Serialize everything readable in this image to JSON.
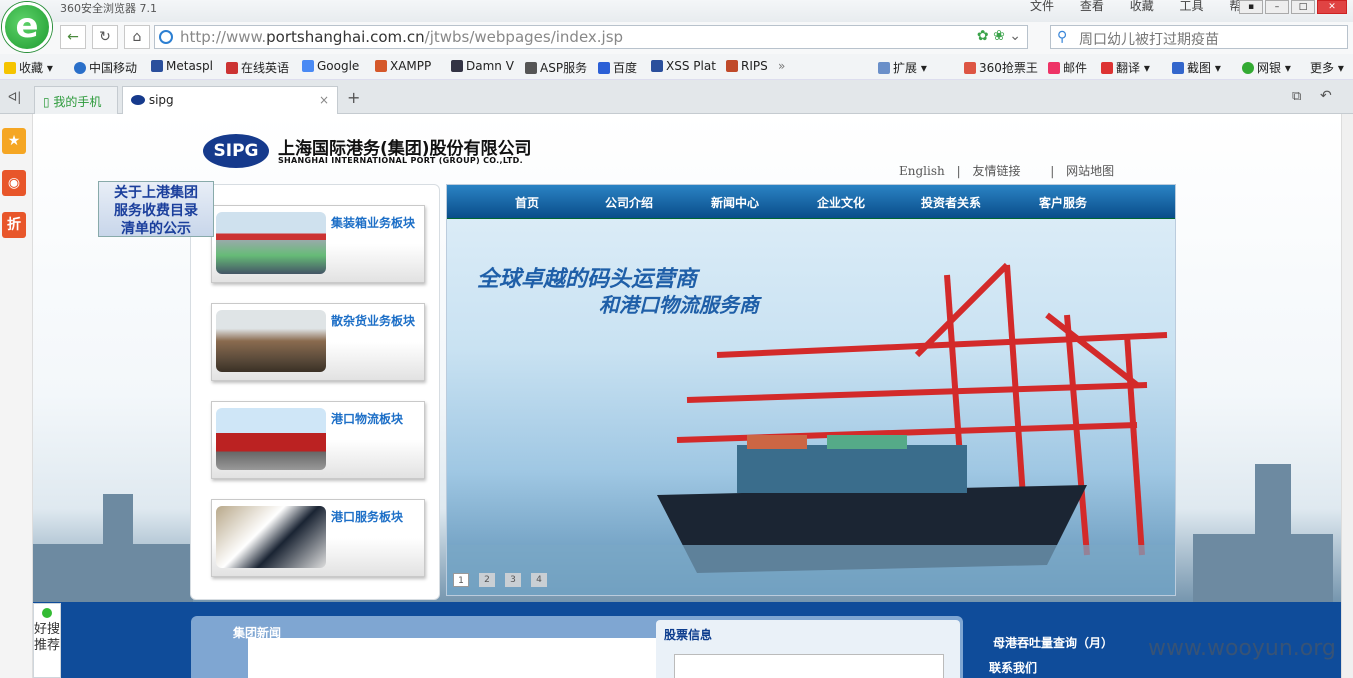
{
  "browser": {
    "app_name": "360安全浏览器 7.1",
    "menu": [
      "文件",
      "查看",
      "收藏",
      "工具",
      "帮助"
    ],
    "url_prefix": "http://www.",
    "url_domain": "portshanghai.com.cn",
    "url_path": "/jtwbs/webpages/index.jsp",
    "search_text": "周口幼儿被打过期疫苗"
  },
  "favorites": {
    "left": [
      "收藏",
      "中国移动",
      "Metaspl",
      "在线英语",
      "Google",
      "XAMPP",
      "Damn V",
      "ASP服务",
      "百度",
      "XSS Plat",
      "RIPS"
    ],
    "right": [
      "扩展",
      "360抢票王",
      "邮件",
      "翻译",
      "截图",
      "网银",
      "更多"
    ]
  },
  "tabs": [
    "我的手机",
    "sipg"
  ],
  "site": {
    "logo_text": "SIPG",
    "company_cn": "上海国际港务(集团)股份有限公司",
    "company_en": "SHANGHAI INTERNATIONAL PORT (GROUP) CO.,LTD.",
    "top_links": [
      "English",
      "|",
      "友情链接",
      "|",
      "网站地图"
    ],
    "notice": [
      "关于上港集团",
      "服务收费目录",
      "清单的公示"
    ],
    "business": [
      "集装箱业务板块",
      "散杂货业务板块",
      "港口物流板块",
      "港口服务板块"
    ],
    "nav": [
      "首页",
      "公司介绍",
      "新闻中心",
      "企业文化",
      "投资者关系",
      "客户服务"
    ],
    "slogan1": "全球卓越的码头运营商",
    "slogan2": "和港口物流服务商",
    "slide_dots": [
      "1",
      "2",
      "3",
      "4"
    ],
    "news_title": "集团新闻",
    "stock_title": "股票信息",
    "right_links": [
      "母港吞吐量查询（月）",
      "联系我们"
    ],
    "sidebar_good": "好搜推荐"
  },
  "watermark": "www.wooyun.org"
}
